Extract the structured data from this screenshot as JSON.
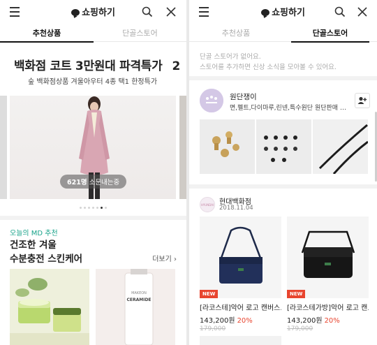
{
  "app": {
    "title": "쇼핑하기"
  },
  "left": {
    "tabs": [
      {
        "label": "추천상품",
        "active": true
      },
      {
        "label": "단골스토어",
        "active": false
      }
    ],
    "promo": {
      "title": "백화점 코트 3만원대 파격특가",
      "peek_text": "2",
      "subtitle": "숲 백화점상품 겨울아우터 4종 택1 한정특가",
      "count_number": "621명",
      "count_label": "소문내는중",
      "dots_total": 7,
      "dots_active_index": 5
    },
    "md": {
      "tag": "오늘의 MD 추천",
      "title_line1": "건조한 겨울",
      "title_line2": "수분충전 스킨케어",
      "more_label": "더보기"
    },
    "products": [
      {
        "label": "CERAMIDE"
      }
    ]
  },
  "right": {
    "tabs": [
      {
        "label": "추천상품",
        "active": false
      },
      {
        "label": "단골스토어",
        "active": true
      }
    ],
    "notice_line1": "단골 스토어가 없어요.",
    "notice_line2": "스토어를 추가하면 신상 소식을 모아볼 수 있어요.",
    "store1": {
      "name": "원단쟁이",
      "description": "면,펠트,다이마루,린넨,특수원단 원단판매 전..."
    },
    "store2": {
      "name": "현대백화점",
      "date": "2018.11.04",
      "items": [
        {
          "badge": "NEW",
          "name": "[라코스테]악어 로고 캔버스...",
          "price": "143,200원",
          "discount": "20%",
          "original": "179,000"
        },
        {
          "badge": "NEW",
          "name": "[라코스테가방]악어 로고 캔...",
          "price": "143,200원",
          "discount": "20%",
          "original": "179,000"
        }
      ]
    }
  },
  "colors": {
    "accent_green": "#18a38a",
    "sale_red": "#e8452f"
  }
}
